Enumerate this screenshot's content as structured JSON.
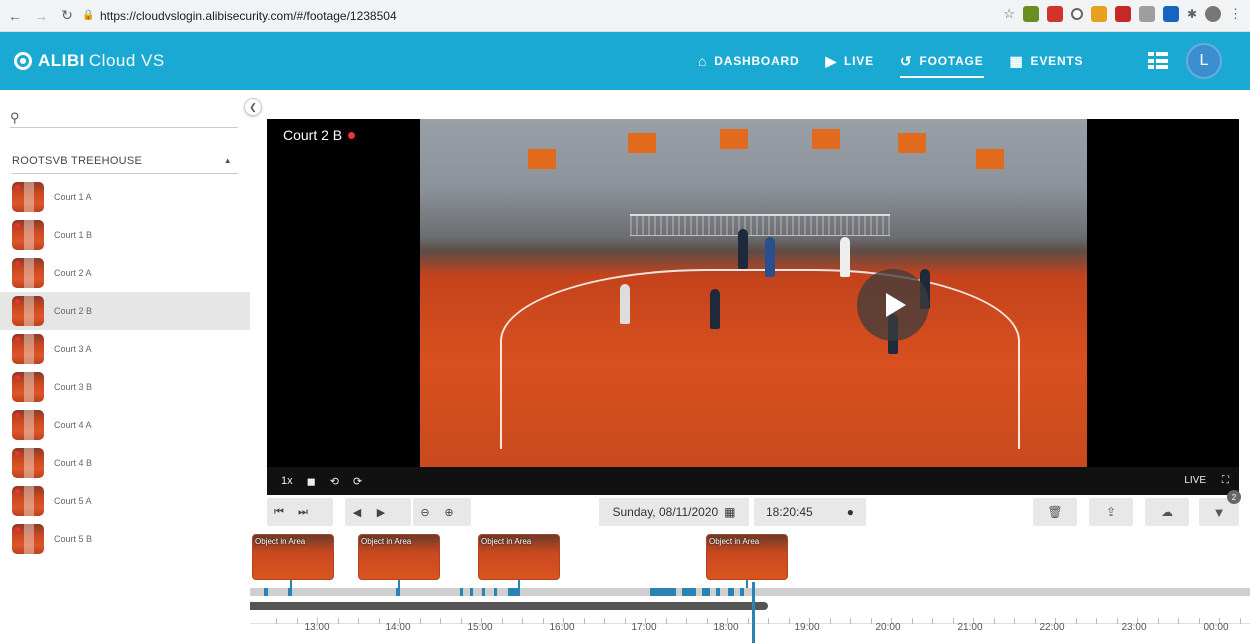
{
  "browser": {
    "url": "https://cloudvslogin.alibisecurity.com/#/footage/1238504"
  },
  "header": {
    "brand": "ALIBI",
    "brand_suffix": "Cloud VS",
    "nav": [
      {
        "label": "DASHBOARD",
        "icon": "home-icon",
        "active": false
      },
      {
        "label": "LIVE",
        "icon": "play-circle-icon",
        "active": false
      },
      {
        "label": "FOOTAGE",
        "icon": "history-icon",
        "active": true
      },
      {
        "label": "EVENTS",
        "icon": "film-icon",
        "active": false
      }
    ],
    "avatar_initial": "L",
    "accent_color": "#1aa9d3"
  },
  "sidebar": {
    "search_placeholder": "",
    "site_name": "ROOTSVB TREEHOUSE",
    "cameras": [
      {
        "label": "Court 1 A",
        "active": false
      },
      {
        "label": "Court 1 B",
        "active": false
      },
      {
        "label": "Court 2 A",
        "active": false
      },
      {
        "label": "Court 2 B",
        "active": true
      },
      {
        "label": "Court 3 A",
        "active": false
      },
      {
        "label": "Court 3 B",
        "active": false
      },
      {
        "label": "Court 4 A",
        "active": false
      },
      {
        "label": "Court 4 B",
        "active": false
      },
      {
        "label": "Court 5 A",
        "active": false
      },
      {
        "label": "Court 5 B",
        "active": false
      }
    ]
  },
  "video": {
    "camera_title": "Court 2 B",
    "speed": "1x",
    "live_label": "LIVE"
  },
  "toolbar": {
    "date": "Sunday, 08/11/2020",
    "time": "18:20:45",
    "filter_badge": "2"
  },
  "timeline": {
    "events": [
      {
        "label": "Object in Area"
      },
      {
        "label": "Object in Area"
      },
      {
        "label": "Object in Area"
      },
      {
        "label": "Object in Area"
      }
    ],
    "hours": [
      "13:00",
      "14:00",
      "15:00",
      "16:00",
      "17:00",
      "18:00",
      "19:00",
      "20:00",
      "21:00",
      "22:00",
      "23:00",
      "00:00"
    ]
  }
}
